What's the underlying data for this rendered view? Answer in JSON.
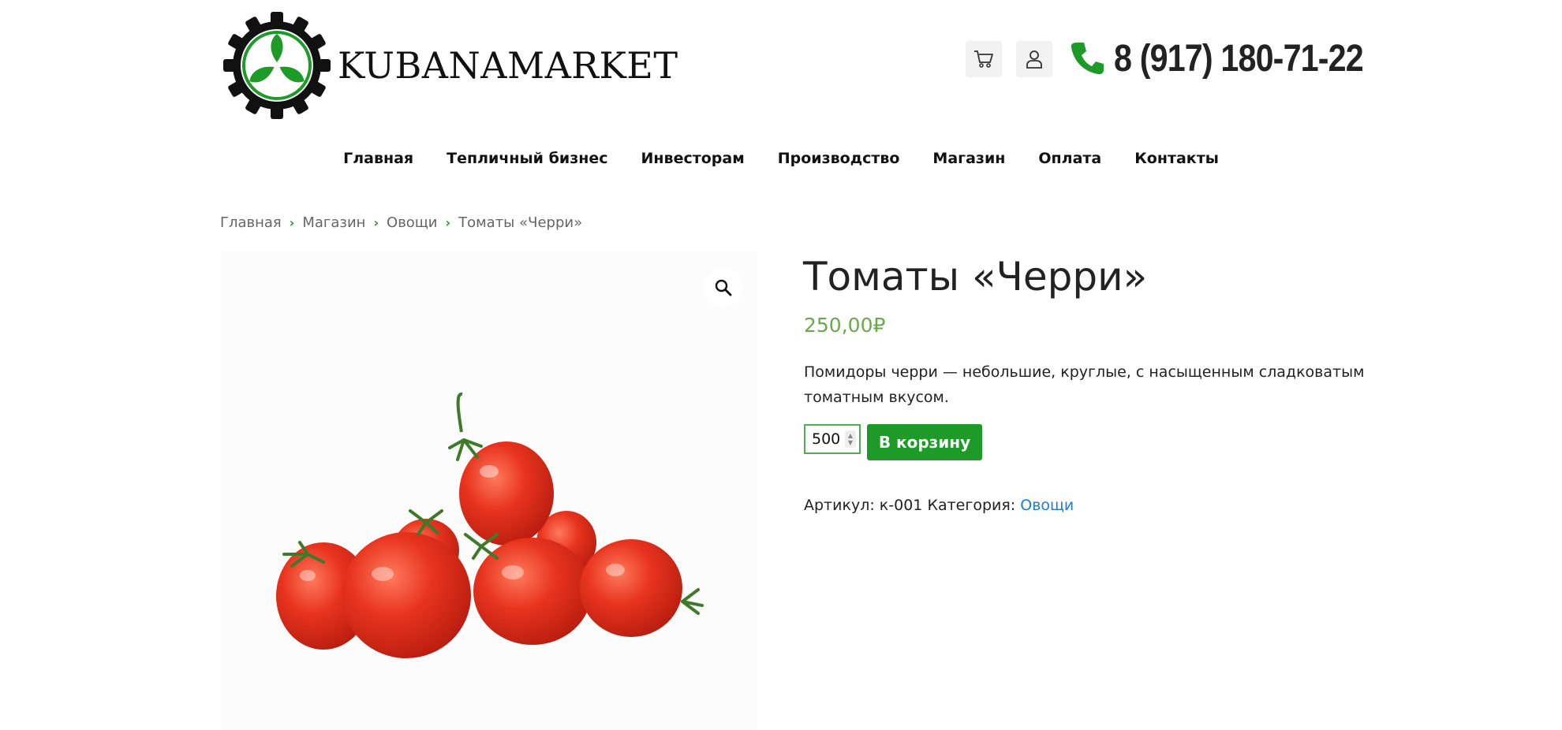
{
  "header": {
    "logo_text": "KUBANAMARKET",
    "phone": "8 (917) 180-71-22"
  },
  "nav": {
    "items": [
      {
        "label": "Главная"
      },
      {
        "label": "Тепличный бизнес"
      },
      {
        "label": "Инвесторам"
      },
      {
        "label": "Производство"
      },
      {
        "label": "Магазин"
      },
      {
        "label": "Оплата"
      },
      {
        "label": "Контакты"
      }
    ]
  },
  "breadcrumb": {
    "items": [
      "Главная",
      "Магазин",
      "Овощи"
    ],
    "current": "Томаты «Черри»"
  },
  "product": {
    "title": "Томаты «Черри»",
    "price": "250,00₽",
    "description": "Помидоры черри — небольшие, круглые, с насыщенным сладковатым томатным вкусом.",
    "quantity": "500",
    "add_to_cart_label": "В корзину",
    "sku_label": "Артикул:",
    "sku": "к-001",
    "category_label": "Категория:",
    "category": "Овощи"
  },
  "icons": {
    "cart": "cart-icon",
    "user": "user-icon",
    "phone": "phone-icon",
    "zoom": "search-icon"
  },
  "colors": {
    "brand_green": "#1e9a28",
    "price_green": "#6aa84f",
    "link_blue": "#1a7fd4",
    "tomato_red": "#e0301e"
  }
}
